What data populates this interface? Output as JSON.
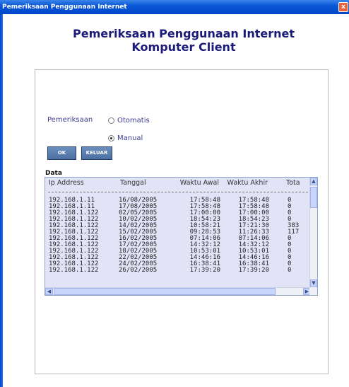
{
  "window": {
    "title": "Pemeriksaan Penggunaan Internet",
    "close_glyph": "x"
  },
  "heading": {
    "line1": "Pemeriksaan Penggunaan  Internet",
    "line2": "Komputer Client"
  },
  "form": {
    "label": "Pemeriksaan",
    "options": [
      {
        "label": "Otomatis",
        "checked": false
      },
      {
        "label": "Manual",
        "checked": true
      }
    ],
    "buttons": {
      "ok": "OK",
      "keluar": "KELUAR"
    }
  },
  "data": {
    "label": "Data",
    "columns": [
      "Ip Address",
      "Tanggal",
      "Waktu Awal",
      "Waktu Akhir",
      "Tota"
    ],
    "rows": [
      [
        "192.168.1.11",
        "16/08/2005",
        "17:58:48",
        "17:58:48",
        "0"
      ],
      [
        "192.168.1.11",
        "17/08/2005",
        "17:58:48",
        "17:58:48",
        "0"
      ],
      [
        "192.168.1.122",
        "02/05/2005",
        "17:00:00",
        "17:00:00",
        "0"
      ],
      [
        "192.168.1.122",
        "10/02/2005",
        "18:54:23",
        "18:54:23",
        "0"
      ],
      [
        "192.168.1.122",
        "14/02/2005",
        "10:58:21",
        "17:21:30",
        "383"
      ],
      [
        "192.168.1.122",
        "15/02/2005",
        "09:28:53",
        "11:26:33",
        "117"
      ],
      [
        "192.168.1.122",
        "16/02/2005",
        "07:14:06",
        "07:14:06",
        "0"
      ],
      [
        "192.168.1.122",
        "17/02/2005",
        "14:32:12",
        "14:32:12",
        "0"
      ],
      [
        "192.168.1.122",
        "18/02/2005",
        "10:53:01",
        "10:53:01",
        "0"
      ],
      [
        "192.168.1.122",
        "22/02/2005",
        "14:46:16",
        "14:46:16",
        "0"
      ],
      [
        "192.168.1.122",
        "24/02/2005",
        "16:38:41",
        "16:38:41",
        "0"
      ],
      [
        "192.168.1.122",
        "26/02/2005",
        "17:39:20",
        "17:39:20",
        "0"
      ]
    ]
  },
  "icons": {
    "scroll_up": "scroll-up-arrow-icon",
    "scroll_down": "scroll-down-arrow-icon",
    "scroll_left": "scroll-left-arrow-icon",
    "scroll_right": "scroll-right-arrow-icon"
  },
  "colors": {
    "titlebar": "#0a58d8",
    "heading": "#1a1a7a",
    "button": "#4b6fa1",
    "listbox_bg": "#e3e3f8"
  }
}
